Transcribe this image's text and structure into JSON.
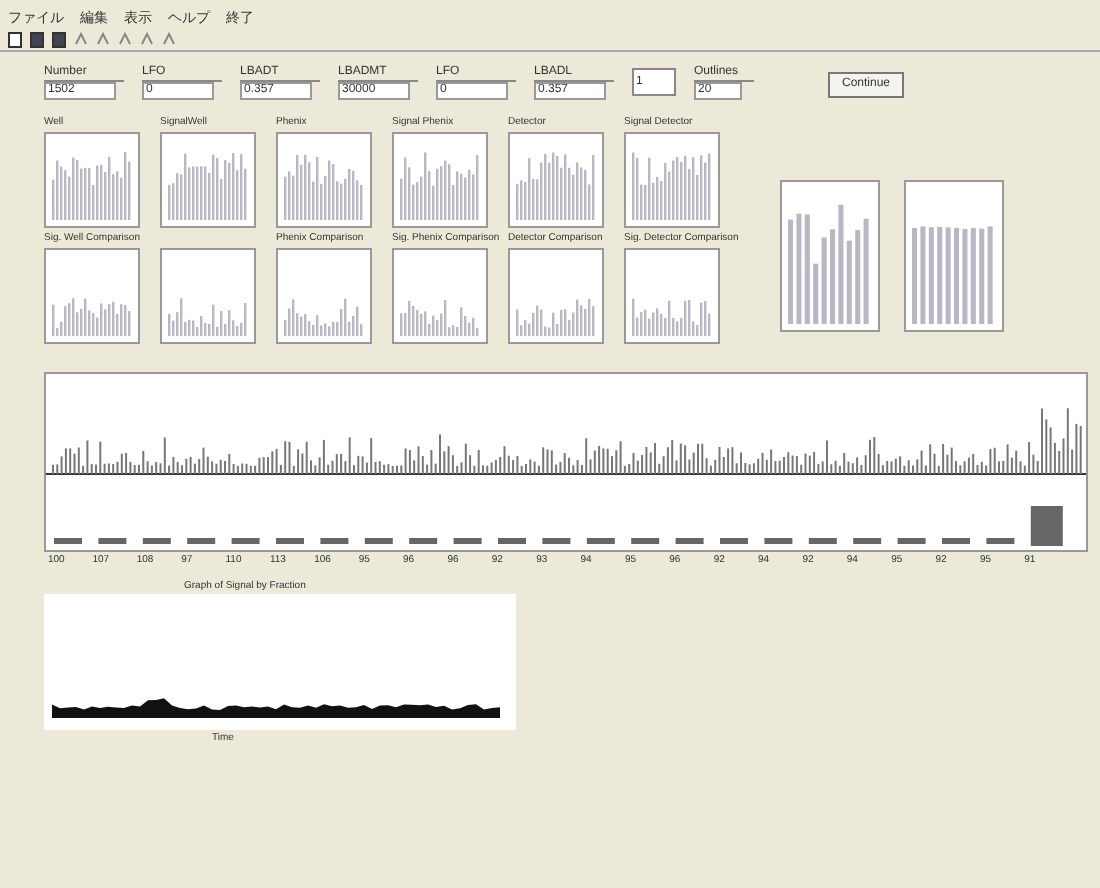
{
  "menu": [
    "ファイル",
    "編集",
    "表示",
    "ヘルプ",
    "終了"
  ],
  "fields": [
    {
      "label": "Number",
      "value": "1502"
    },
    {
      "label": "LFO",
      "value": "0"
    },
    {
      "label": "LBADT",
      "value": "0.357"
    },
    {
      "label": "LBADMT",
      "value": "30000"
    },
    {
      "label": "LFO",
      "value": "0"
    },
    {
      "label": "LBADL",
      "value": "0.357"
    }
  ],
  "count_field": {
    "value": "1"
  },
  "outline_field": {
    "label": "Outlines",
    "value": "20"
  },
  "continue_button": "Continue",
  "top_charts": [
    "Well",
    "SignalWell",
    "Phenix",
    "Signal Phenix",
    "Detector",
    "Signal Detector"
  ],
  "comparison_charts": [
    {
      "kind": "labeled",
      "label": "Sig. Well Comparison"
    },
    {
      "kind": "unlabeled"
    },
    {
      "kind": "labeled",
      "label": "Phenix Comparison"
    },
    {
      "kind": "labeled",
      "label": "Sig. Phenix Comparison"
    },
    {
      "kind": "labeled",
      "label": "Detector Comparison"
    },
    {
      "kind": "labeled",
      "label": "Sig. Detector Comparison"
    }
  ],
  "timeline_labels": [
    "100",
    "107",
    "108",
    "97",
    "110",
    "113",
    "106",
    "95",
    "96",
    "96",
    "92",
    "93",
    "94",
    "95",
    "96",
    "92",
    "94",
    "92",
    "94",
    "95",
    "92",
    "95",
    "91"
  ],
  "signal_chart": {
    "title": "Graph of Signal by Fraction",
    "xlabel": "Time"
  }
}
